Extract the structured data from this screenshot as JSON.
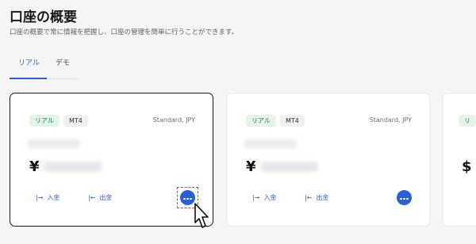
{
  "header": {
    "title": "口座の概要",
    "subtitle": "口座の概要で常に情報を把握し、口座の管理を簡単に行うことができます。"
  },
  "tabs": [
    {
      "label": "リアル",
      "active": true
    },
    {
      "label": "デモ",
      "active": false
    }
  ],
  "accounts": [
    {
      "badge": "リアル",
      "platform": "MT4",
      "type": "Standard, JPY",
      "currency_symbol": "¥",
      "deposit_label": "入金",
      "withdraw_label": "出金",
      "selected": true
    },
    {
      "badge": "リアル",
      "platform": "MT4",
      "type": "Standard, JPY",
      "currency_symbol": "¥",
      "deposit_label": "入金",
      "withdraw_label": "出金",
      "selected": false
    },
    {
      "badge": "リ",
      "currency_symbol": "$"
    }
  ],
  "icons": {
    "deposit": "arrow-right-to-bar-icon",
    "withdraw": "arrow-left-from-bar-icon",
    "more": "more-dots-icon",
    "cursor": "hand-pointer-cursor"
  },
  "colors": {
    "accent": "#2b5fd9",
    "real_badge_bg": "#e4f4ea",
    "real_badge_text": "#2e7d4f",
    "highlight": "#c8454a"
  }
}
